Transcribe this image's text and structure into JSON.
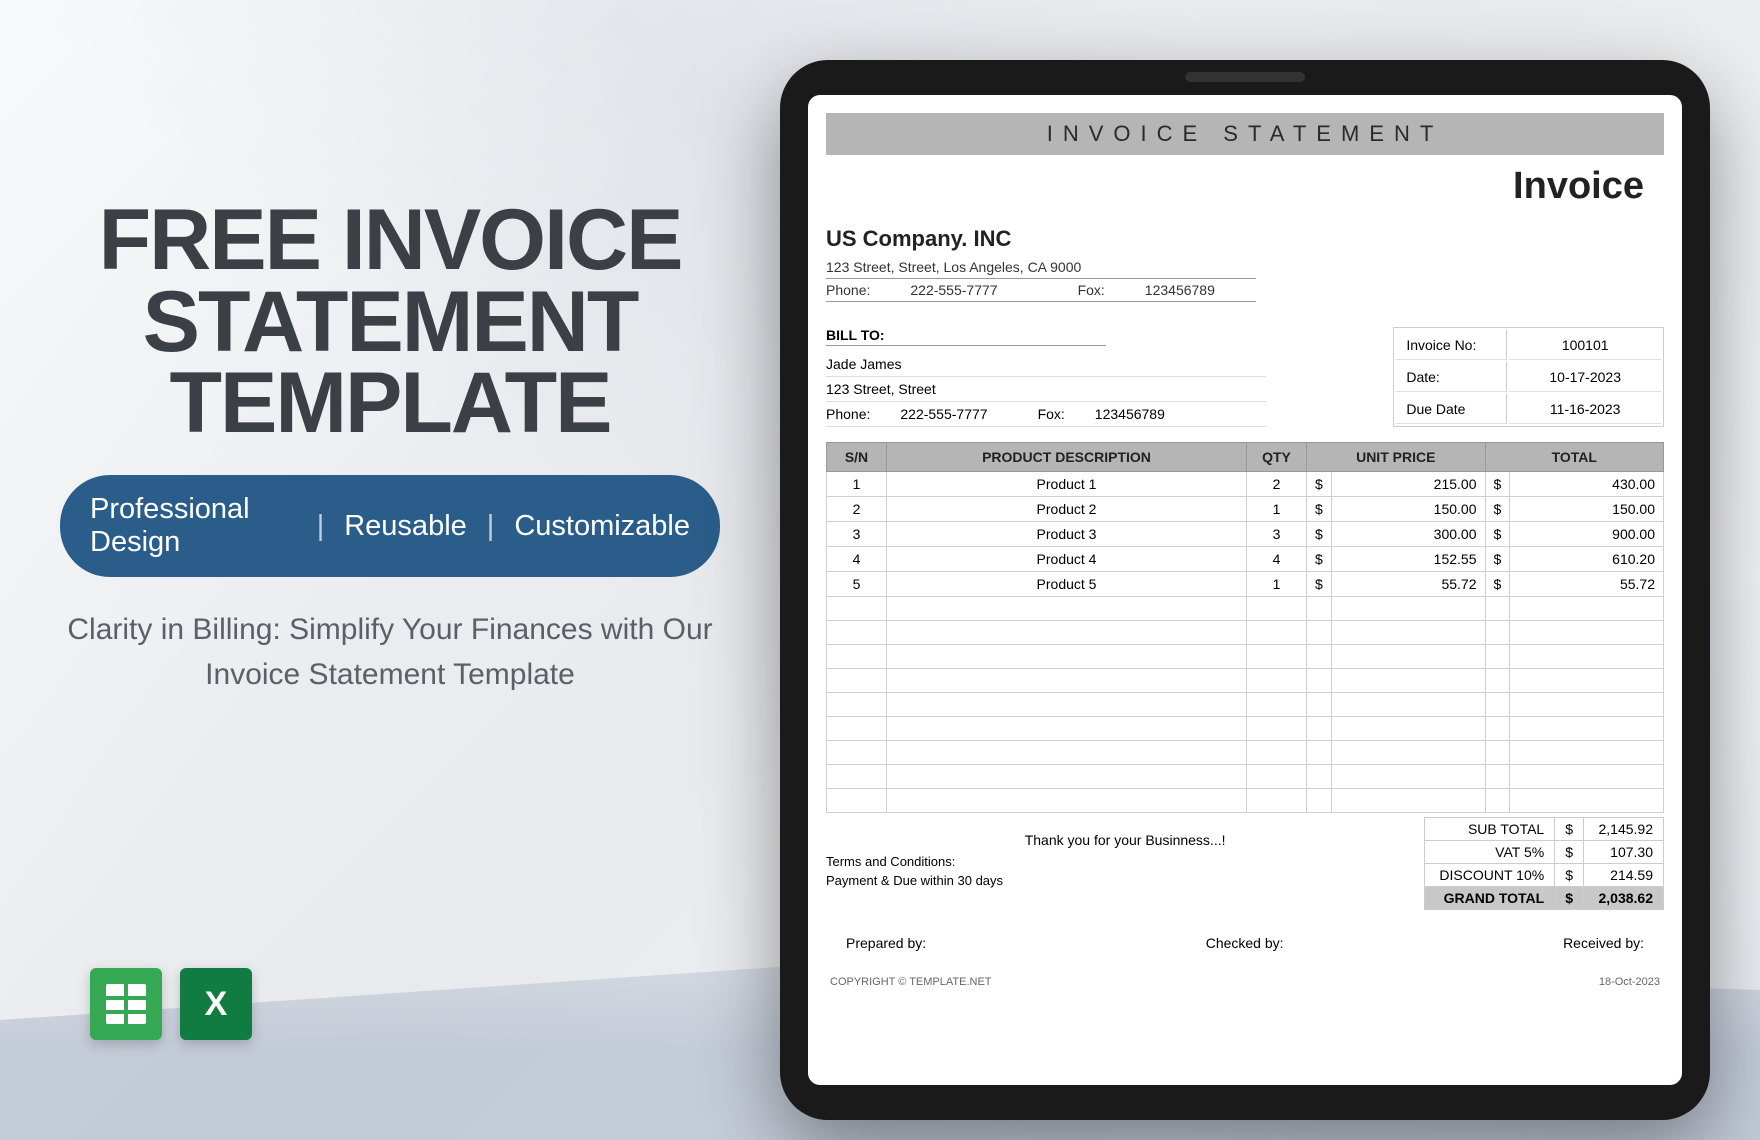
{
  "promo": {
    "title_l1": "FREE INVOICE",
    "title_l2": "STATEMENT TEMPLATE",
    "pill": {
      "a": "Professional Design",
      "b": "Reusable",
      "c": "Customizable"
    },
    "subtitle": "Clarity in Billing: Simplify Your Finances with Our Invoice Statement Template",
    "icons": {
      "sheets": "google-sheets-icon",
      "excel": "excel-icon"
    }
  },
  "invoice": {
    "banner": "INVOICE STATEMENT",
    "title": "Invoice",
    "company": {
      "name": "US Company. INC",
      "address": "123 Street, Street, Los Angeles, CA 9000",
      "phone_lbl": "Phone:",
      "phone": "222-555-7777",
      "fax_lbl": "Fox:",
      "fax": "123456789"
    },
    "bill_to": {
      "label": "BILL TO:",
      "name": "Jade James",
      "address": "123 Street, Street",
      "phone_lbl": "Phone:",
      "phone": "222-555-7777",
      "fax_lbl": "Fox:",
      "fax": "123456789"
    },
    "meta": {
      "no_lbl": "Invoice No:",
      "no_val": "100101",
      "date_lbl": "Date:",
      "date_val": "10-17-2023",
      "due_lbl": "Due Date",
      "due_val": "11-16-2023"
    },
    "headers": {
      "sn": "S/N",
      "desc": "PRODUCT DESCRIPTION",
      "qty": "QTY",
      "unit": "UNIT PRICE",
      "total": "TOTAL"
    },
    "rows": [
      {
        "sn": "1",
        "desc": "Product 1",
        "qty": "2",
        "unit": "215.00",
        "total": "430.00"
      },
      {
        "sn": "2",
        "desc": "Product 2",
        "qty": "1",
        "unit": "150.00",
        "total": "150.00"
      },
      {
        "sn": "3",
        "desc": "Product 3",
        "qty": "3",
        "unit": "300.00",
        "total": "900.00"
      },
      {
        "sn": "4",
        "desc": "Product 4",
        "qty": "4",
        "unit": "152.55",
        "total": "610.20"
      },
      {
        "sn": "5",
        "desc": "Product 5",
        "qty": "1",
        "unit": "55.72",
        "total": "55.72"
      }
    ],
    "thanks": "Thank you for your Businness...!",
    "terms": {
      "hdr": "Terms and Conditions:",
      "body": "Payment & Due within 30 days"
    },
    "totals": {
      "sub_lbl": "SUB TOTAL",
      "sub_val": "2,145.92",
      "vat_lbl": "VAT 5%",
      "vat_val": "107.30",
      "disc_lbl": "DISCOUNT 10%",
      "disc_val": "214.59",
      "grand_lbl": "GRAND TOTAL",
      "grand_val": "2,038.62",
      "currency": "$"
    },
    "sigs": {
      "prep": "Prepared by:",
      "check": "Checked by:",
      "recv": "Received by:"
    },
    "copyright": {
      "text": "COPYRIGHT © TEMPLATE.NET",
      "date": "18-Oct-2023"
    }
  }
}
